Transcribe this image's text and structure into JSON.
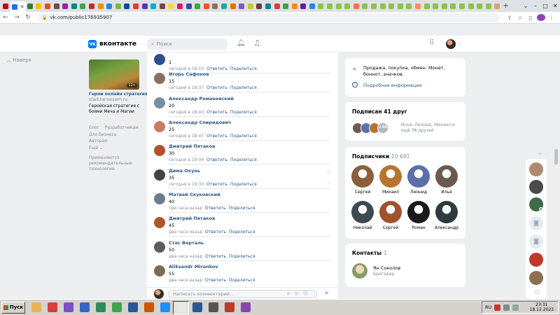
{
  "browser": {
    "url": "vk.com/public176935907",
    "tab_favicon_colors": [
      "#cc0000",
      "#1a73e8",
      "#2e7d32",
      "#fbbc04",
      "#e65100",
      "#6d4c41",
      "#8e24aa",
      "#00897b",
      "#43a047",
      "#c62828",
      "#fb8c00",
      "#1e88e5",
      "#7cb342",
      "#0d47a1",
      "#e53935",
      "#5e35b1",
      "#00acc1",
      "#6d4c41",
      "#fdd835",
      "#d81b60",
      "#3949ab",
      "#43a047",
      "#f4511e",
      "#8d6e63",
      "#26a69a",
      "#ef6c00",
      "#7e57c2",
      "#c0ca33",
      "#5d4037",
      "#00838f",
      "#e53935",
      "#43a047",
      "#fb8c00",
      "#6a1b9a",
      "#1e88e5",
      "#8bc34a",
      "#8bc34a",
      "#8bc34a",
      "#8bc34a",
      "#ff7043",
      "#8bc34a",
      "#8bc34a",
      "#8bc34a",
      "#8bc34a",
      "#8bc34a",
      "#8bc34a",
      "#ff8a65",
      "#8bc34a",
      "#8bc34a",
      "#8bc34a",
      "#8bc34a",
      "#8bc34a",
      "#8bc34a",
      "#8bc34a",
      "#8bc34a",
      "#d4a373"
    ]
  },
  "vk": {
    "logo_text": "вконтакте",
    "logo_mark": "VK",
    "search_placeholder": "Поиск"
  },
  "left": {
    "back": "Наверх",
    "ad": {
      "age": "12+",
      "title": "Герои онлайн стратегия",
      "url": "start.heroeswm.ru",
      "desc": "Геройская стратегия с боями Меча и Магии"
    },
    "links_row1": [
      "Блог",
      "Разработчикам"
    ],
    "links_row2": [
      "Для бизнеса",
      "Авторам"
    ],
    "links_row3": "Ещё ⌄",
    "note": "Применяются рекомендательные технологии"
  },
  "comments": {
    "reply_label": "Ответить",
    "share_label": "Поделиться",
    "compose_placeholder": "Написать комментарий...",
    "items": [
      {
        "name": "",
        "text": "1",
        "time": "сегодня в 18:15",
        "avatar": "#2b4f8c"
      },
      {
        "name": "Игорь Сафонов",
        "text": "15",
        "time": "сегодня в 18:37",
        "avatar": "#8d6e63"
      },
      {
        "name": "Александр Романовский",
        "text": "20",
        "time": "сегодня в 18:43",
        "avatar": "#78909c"
      },
      {
        "name": "Александр Спиридович",
        "text": "25",
        "time": "сегодня в 18:47",
        "avatar": "#c97b63"
      },
      {
        "name": "Дмитрий Пятаков",
        "text": "30",
        "time": "сегодня в 19:04",
        "avatar": "#b0522f"
      },
      {
        "name": "Дима Окунь",
        "text": "35",
        "time": "сегодня в 19:30",
        "avatar": "#424242"
      },
      {
        "name": "Матвей Скуковский",
        "text": "40",
        "time": "три часа назад",
        "avatar": "#6b7b8c"
      },
      {
        "name": "Дмитрий Пятаков",
        "text": "45",
        "time": "два часа назад",
        "avatar": "#b0522f"
      },
      {
        "name": "Стас Верталь",
        "text": "50",
        "time": "два часа назад",
        "avatar": "#5d5d5d"
      },
      {
        "name": "Aliksandr Mirankov",
        "text": "55",
        "time": "два часа назад",
        "avatar": "#7d6b5a"
      }
    ]
  },
  "info": {
    "text": "Продажа, покупка, обмен. Монет, боннот, значков.",
    "more": "Подробная информация"
  },
  "friends": {
    "title": "Подписан 41 друг",
    "plus": "+38",
    "text": "Илья, Леонид, Михаил и ещё 38 друзей"
  },
  "subscribers": {
    "title": "Подписчики",
    "count": "10 641",
    "people": [
      {
        "name": "Сергей",
        "color": "#8b5e3c"
      },
      {
        "name": "Михаил",
        "color": "#b8742e"
      },
      {
        "name": "Леонид",
        "color": "#5b6fa8"
      },
      {
        "name": "Илья",
        "color": "#6b5b4e"
      },
      {
        "name": "Николай",
        "color": "#3e4a52"
      },
      {
        "name": "Сергей",
        "color": "#a0522d"
      },
      {
        "name": "Роман",
        "color": "#1a1a1a"
      },
      {
        "name": "Александр",
        "color": "#2e3b3f"
      }
    ]
  },
  "contacts": {
    "title": "Контакты",
    "count": "1",
    "name": "Ян Соколов",
    "role": "Бригадир"
  },
  "taskbar": {
    "start_label": "Пуск",
    "lang": "RU",
    "time": "23:31",
    "date": "18.12.2023",
    "app_colors": [
      "#e6b35a",
      "#d8403a",
      "#7b4fc9",
      "#3a63c4",
      "#2e8b57",
      "#3fa34d",
      "#2b5797",
      "#d35400",
      "#1e90ff",
      "#e8e8e8",
      "#2b5797",
      "#555555",
      "#c0392b",
      "#8e44ad"
    ]
  }
}
